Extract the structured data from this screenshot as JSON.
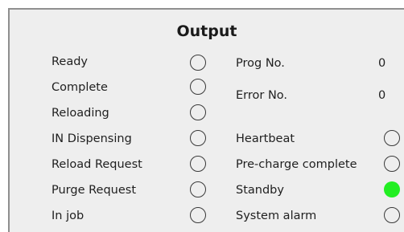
{
  "title": "Output",
  "left_signals": [
    {
      "label": "Ready",
      "on": false
    },
    {
      "label": "Complete",
      "on": false
    },
    {
      "label": "Reloading",
      "on": false
    },
    {
      "label": "IN Dispensing",
      "on": false
    },
    {
      "label": "Reload Request",
      "on": false
    },
    {
      "label": "Purge Request",
      "on": false
    },
    {
      "label": "In job",
      "on": false
    }
  ],
  "counters": [
    {
      "label": "Prog No.",
      "value": "0"
    },
    {
      "label": "Error No.",
      "value": "0"
    }
  ],
  "right_signals": [
    {
      "label": "Heartbeat",
      "on": false
    },
    {
      "label": "Pre-charge complete",
      "on": false
    },
    {
      "label": "Standby",
      "on": true
    },
    {
      "label": "System alarm",
      "on": false
    }
  ],
  "colors": {
    "lamp_on": "#22ee22"
  }
}
